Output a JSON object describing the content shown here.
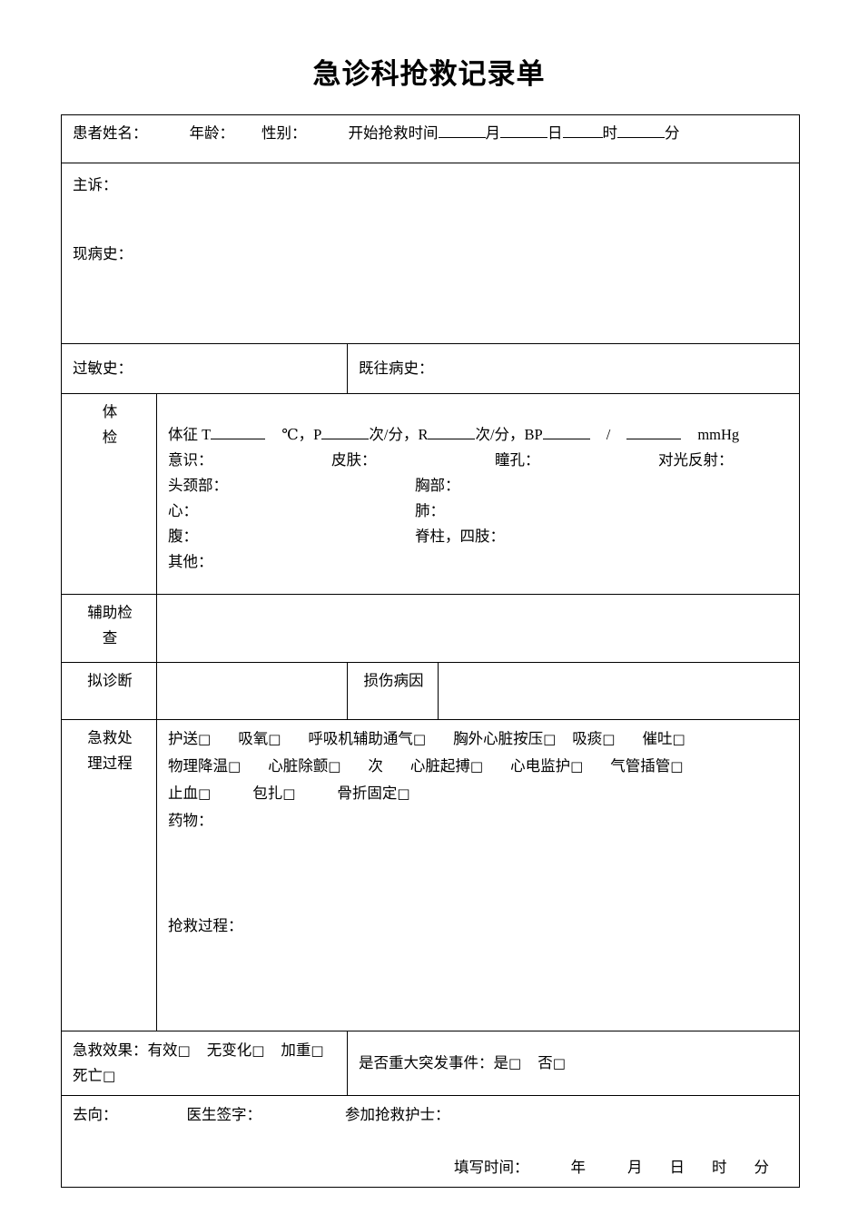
{
  "document": {
    "title": "急诊科抢救记录单"
  },
  "patient_row": {
    "name_label": "患者姓名：",
    "age_label": "年龄：",
    "gender_label": "性别：",
    "start_time_label": "开始抢救时间",
    "month_unit": "月",
    "day_unit": "日",
    "hour_unit": "时",
    "minute_unit": "分"
  },
  "history": {
    "chief_complaint_label": "主诉：",
    "present_illness_label": "现病史："
  },
  "allergy_row": {
    "allergy_label": "过敏史：",
    "past_history_label": "既往病史："
  },
  "physical_exam": {
    "section_label": "体检",
    "section_label_char1": "体",
    "section_label_char2": "检",
    "vitals_prefix": "体征 T",
    "temp_unit": "℃，P",
    "pulse_unit": "次/分，R",
    "resp_unit": "次/分，BP",
    "bp_sep": "/",
    "bp_unit": "mmHg",
    "consciousness_label": "意识：",
    "skin_label": "皮肤：",
    "pupil_label": "瞳孔：",
    "light_reflex_label": "对光反射：",
    "head_neck_label": "头颈部：",
    "chest_label": "胸部：",
    "heart_label": "心：",
    "lung_label": "肺：",
    "abdomen_label": "腹：",
    "spine_limbs_label": "脊柱，四肢：",
    "other_label": "其他："
  },
  "auxiliary": {
    "label": "辅助检查",
    "label_line1": "辅助检",
    "label_line2": "查"
  },
  "diagnosis_row": {
    "diagnosis_label": "拟诊断",
    "injury_cause_label": "损伤病因"
  },
  "emergency_process": {
    "section_label": "急救处理过程",
    "section_label_line1": "急救处",
    "section_label_line2": "理过程",
    "checkbox_rows": [
      [
        {
          "label": "护送",
          "box": "□"
        },
        {
          "label": "吸氧",
          "box": "□"
        },
        {
          "label": "呼吸机辅助通气",
          "box": "□"
        },
        {
          "label": "胸外心脏按压",
          "box": "□"
        },
        {
          "label": "吸痰",
          "box": "□"
        },
        {
          "label": "催吐",
          "box": "□"
        }
      ],
      [
        {
          "label": "物理降温",
          "box": "□"
        },
        {
          "label": "心脏除颤",
          "box": "□"
        },
        {
          "label": "次",
          "box": ""
        },
        {
          "label": "心脏起搏",
          "box": "□"
        },
        {
          "label": "心电监护",
          "box": "□"
        },
        {
          "label": "气管插管",
          "box": "□"
        }
      ],
      [
        {
          "label": "止血",
          "box": "□"
        },
        {
          "label": "包扎",
          "box": "□"
        },
        {
          "label": "骨折固定",
          "box": "□"
        }
      ]
    ],
    "medication_label": "药物：",
    "rescue_process_label": "抢救过程："
  },
  "outcome_row": {
    "effect_label": "急救效果：",
    "effect_options": [
      {
        "label": "有效",
        "box": "□"
      },
      {
        "label": "无变化",
        "box": "□"
      },
      {
        "label": "加重",
        "box": "□"
      },
      {
        "label": "死亡",
        "box": "□"
      }
    ],
    "major_event_label": "是否重大突发事件：",
    "major_event_options": [
      {
        "label": "是",
        "box": "□"
      },
      {
        "label": "否",
        "box": "□"
      }
    ]
  },
  "footer": {
    "destination_label": "去向：",
    "doctor_signature_label": "医生签字：",
    "nurse_label": "参加抢救护士：",
    "fill_time_label": "填写时间：",
    "year_unit": "年",
    "month_unit": "月",
    "day_unit": "日",
    "hour_unit": "时",
    "minute_unit": "分"
  },
  "colors": {
    "border": "#000000",
    "text": "#000000",
    "background": "#ffffff"
  }
}
